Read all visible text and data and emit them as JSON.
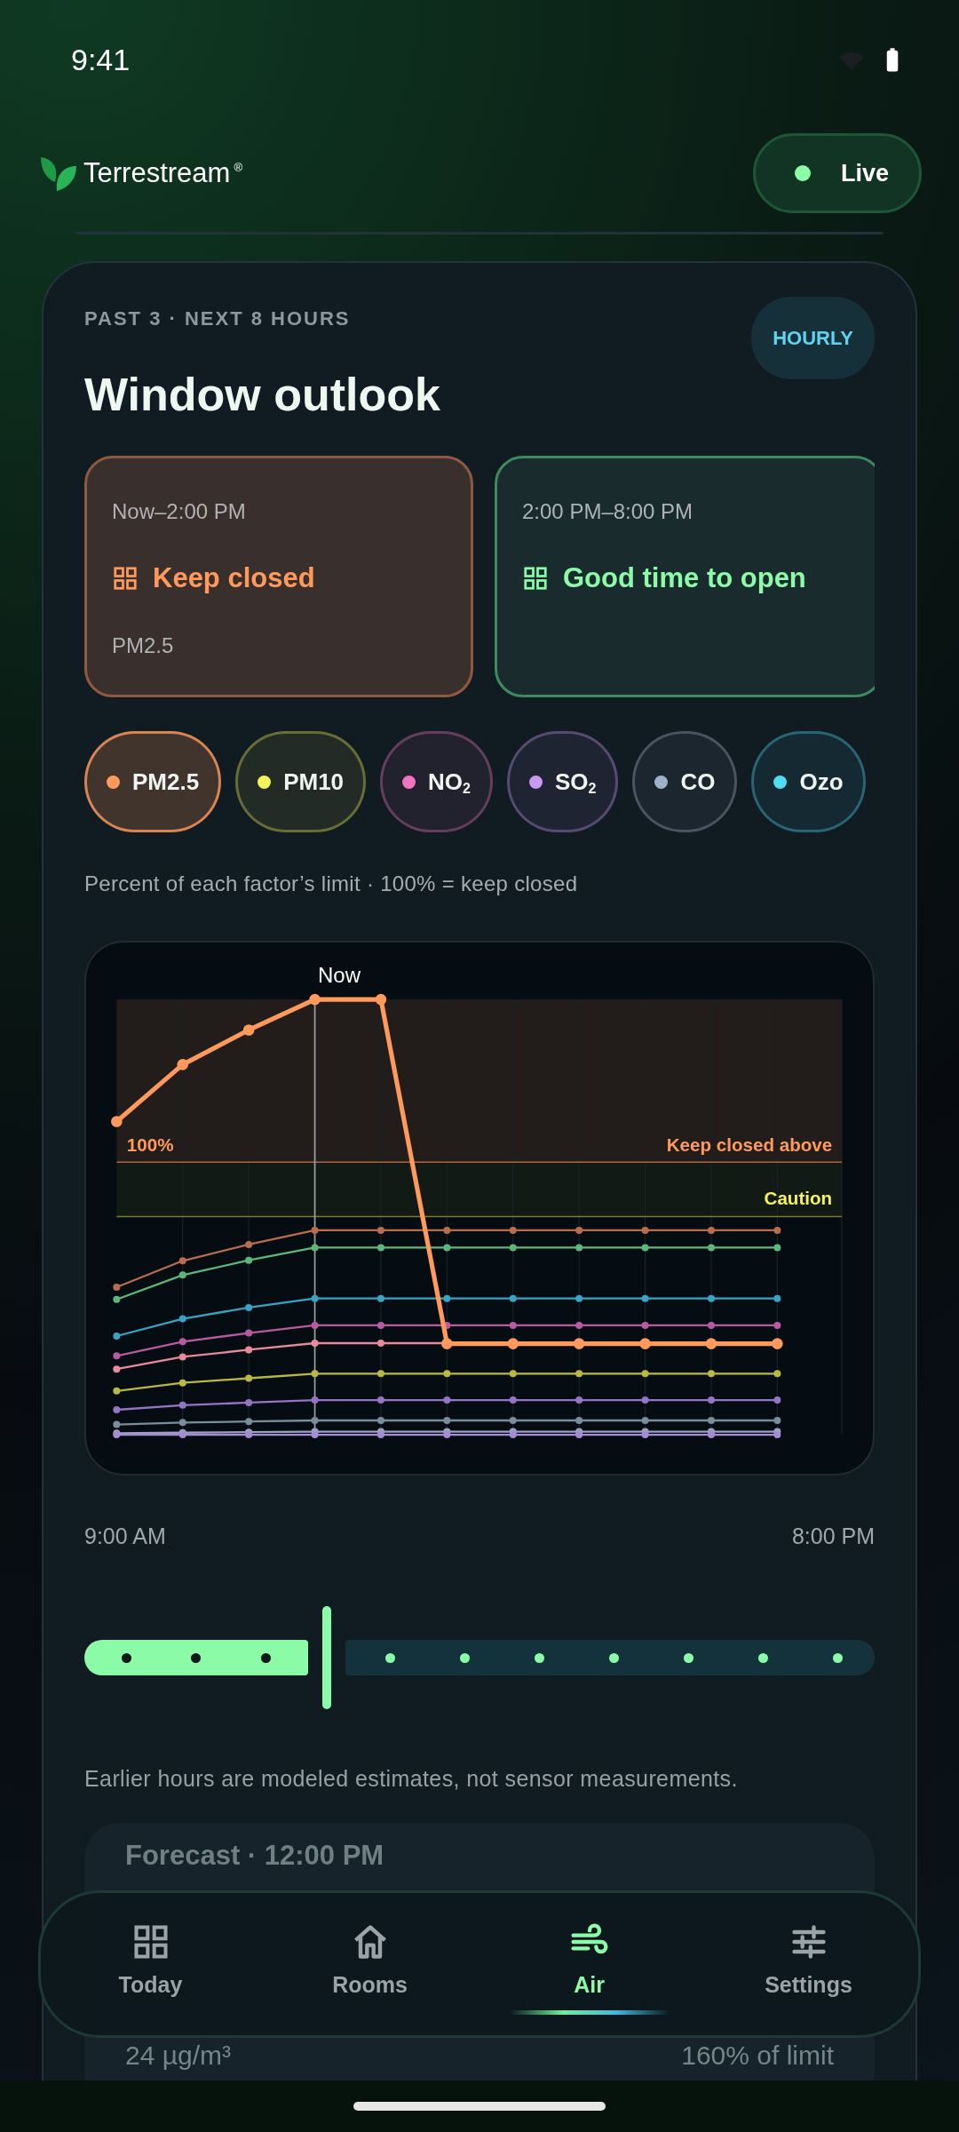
{
  "status_bar": {
    "time": "9:41"
  },
  "header": {
    "brand": "Terrestream",
    "brand_mark": "®",
    "live": {
      "label": "Live",
      "on": true
    }
  },
  "outlook": {
    "eyebrow": "PAST 3 · NEXT 8 HOURS",
    "badge": "HOURLY",
    "title": "Window outlook",
    "windows": [
      {
        "kind": "closed",
        "time": "Now–2:00 PM",
        "status": "Keep closed",
        "factor": "PM2.5"
      },
      {
        "kind": "open",
        "time": "2:00 PM–8:00 PM",
        "status": "Good time to open"
      }
    ],
    "factors": [
      {
        "label": "PM2.5",
        "color": "#ff9a5c",
        "selected": true
      },
      {
        "label": "PM10",
        "color": "#f5f25a",
        "selected": false
      },
      {
        "label": "NO$_{2}$",
        "color": "#f075c0",
        "selected": false
      },
      {
        "label": "SO$_{2}$",
        "color": "#c79af0",
        "selected": false
      },
      {
        "label": "CO",
        "color": "#9fb3c8",
        "selected": false
      },
      {
        "label": "Ozo",
        "color": "#4fdcf5",
        "selected": false
      }
    ],
    "caption": "Percent of each factor’s limit · 100% = keep closed",
    "chart": {
      "now_label": "Now",
      "limit_label": "100%",
      "keep_closed_label": "Keep closed above",
      "caution_label": "Caution"
    },
    "range": {
      "start": "9:00 AM",
      "end": "8:00 PM"
    },
    "timeline": [
      {
        "kind": "past"
      },
      {
        "kind": "past"
      },
      {
        "kind": "past"
      },
      {
        "kind": "future"
      },
      {
        "kind": "future"
      },
      {
        "kind": "future"
      },
      {
        "kind": "future"
      },
      {
        "kind": "future"
      },
      {
        "kind": "future"
      },
      {
        "kind": "future"
      }
    ],
    "note": "Earlier hours are modeled estimates, not sensor measurements."
  },
  "forecast": {
    "title": "Forecast · 12:00 PM",
    "value": "24 µg/m³",
    "share": "160% of limit"
  },
  "nav": [
    {
      "kind": "today",
      "label": "Today",
      "selected": false
    },
    {
      "kind": "rooms",
      "label": "Rooms",
      "selected": false
    },
    {
      "kind": "air",
      "label": "Air",
      "selected": true
    },
    {
      "kind": "settings",
      "label": "Settings",
      "selected": false
    }
  ]
}
